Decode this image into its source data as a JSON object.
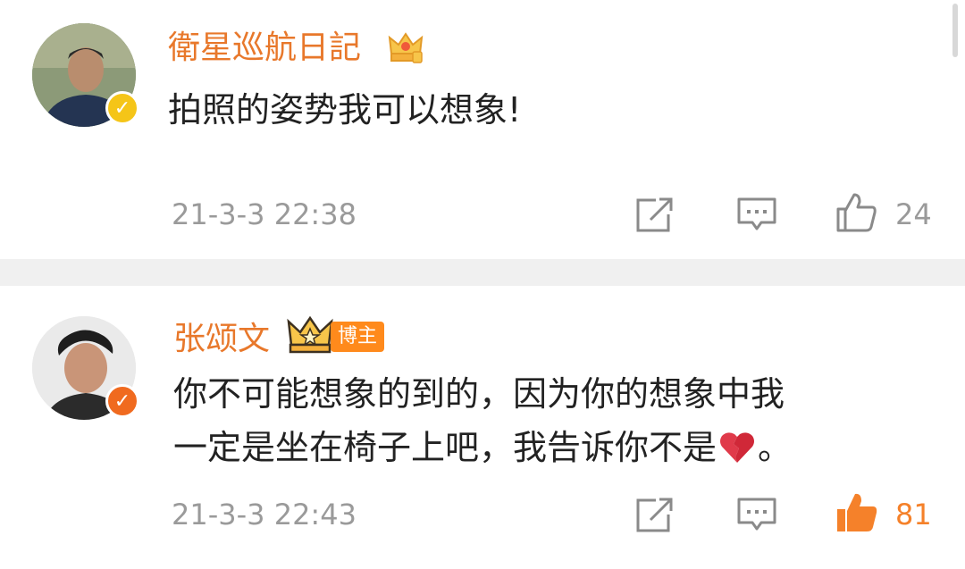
{
  "comments": [
    {
      "username": "衛星巡航日記",
      "verified_type": "yellow",
      "content": "拍照的姿势我可以想象!",
      "time": "21-3-3 22:38",
      "likes": "24",
      "liked": false
    },
    {
      "username": "张颂文",
      "verified_type": "orange",
      "badge": "博主",
      "content_line1": "你不可能想象的到的，因为你的想象中我",
      "content_line2": "一定是坐在椅子上吧，我告诉你不是",
      "content_line2_suffix": "。",
      "emoji": "broken-heart",
      "time": "21-3-3 22:43",
      "likes": "81",
      "liked": true
    }
  ],
  "colors": {
    "username": "#e8782b",
    "liked": "#f5812a",
    "muted": "#9a9a9a"
  }
}
